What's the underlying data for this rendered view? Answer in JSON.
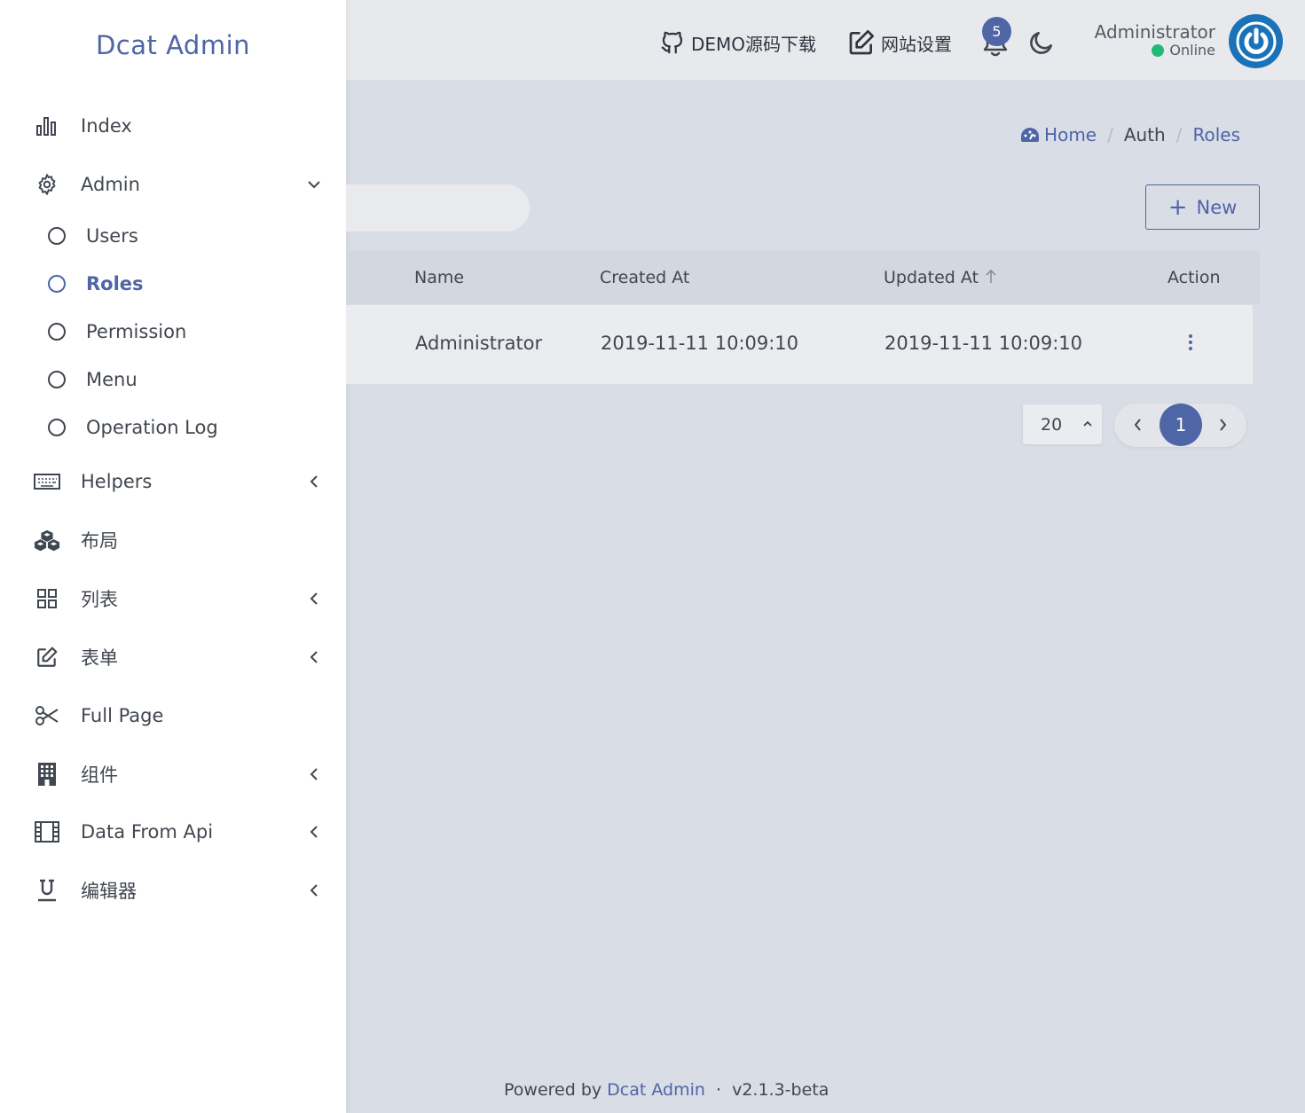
{
  "brand": "Dcat Admin",
  "header": {
    "links": [
      {
        "label": "DEMO源码下载",
        "icon": "github-icon"
      },
      {
        "label": "网站设置",
        "icon": "edit-icon"
      }
    ],
    "notifications_count": "5",
    "user": {
      "name": "Administrator",
      "status": "Online"
    }
  },
  "sidebar": {
    "items": [
      {
        "label": "Index",
        "icon": "bar-chart-icon"
      },
      {
        "label": "Admin",
        "icon": "gear-icon",
        "expanded": true
      },
      {
        "label": "Users",
        "icon": "circle-icon"
      },
      {
        "label": "Roles",
        "icon": "circle-icon",
        "active": true
      },
      {
        "label": "Permission",
        "icon": "circle-icon"
      },
      {
        "label": "Menu",
        "icon": "circle-icon"
      },
      {
        "label": "Operation Log",
        "icon": "circle-icon"
      },
      {
        "label": "Helpers",
        "icon": "keyboard-icon"
      },
      {
        "label": "布局",
        "icon": "cubes-icon"
      },
      {
        "label": "列表",
        "icon": "grid-icon"
      },
      {
        "label": "表单",
        "icon": "edit-icon"
      },
      {
        "label": "Full Page",
        "icon": "scissors-icon"
      },
      {
        "label": "组件",
        "icon": "building-icon"
      },
      {
        "label": "Data From Api",
        "icon": "film-icon"
      },
      {
        "label": "编辑器",
        "icon": "underline-icon"
      }
    ]
  },
  "breadcrumb": {
    "home": "Home",
    "auth": "Auth",
    "current": "Roles",
    "separator": "/"
  },
  "toolbar": {
    "new_label": "New"
  },
  "table": {
    "columns": {
      "name": "Name",
      "created_at": "Created At",
      "updated_at": "Updated At",
      "action": "Action"
    },
    "rows": [
      {
        "name": "Administrator",
        "created_at": "2019-11-11 10:09:10",
        "updated_at": "2019-11-11 10:09:10"
      }
    ]
  },
  "pagination": {
    "per_page": "20",
    "current_page": "1"
  },
  "footer": {
    "prefix": "Powered by",
    "link": "Dcat Admin",
    "separator": "·",
    "version": "v2.1.3-beta"
  },
  "colors": {
    "accent": "#4e65a6",
    "online": "#21b978",
    "avatar": "#1a73b8"
  }
}
